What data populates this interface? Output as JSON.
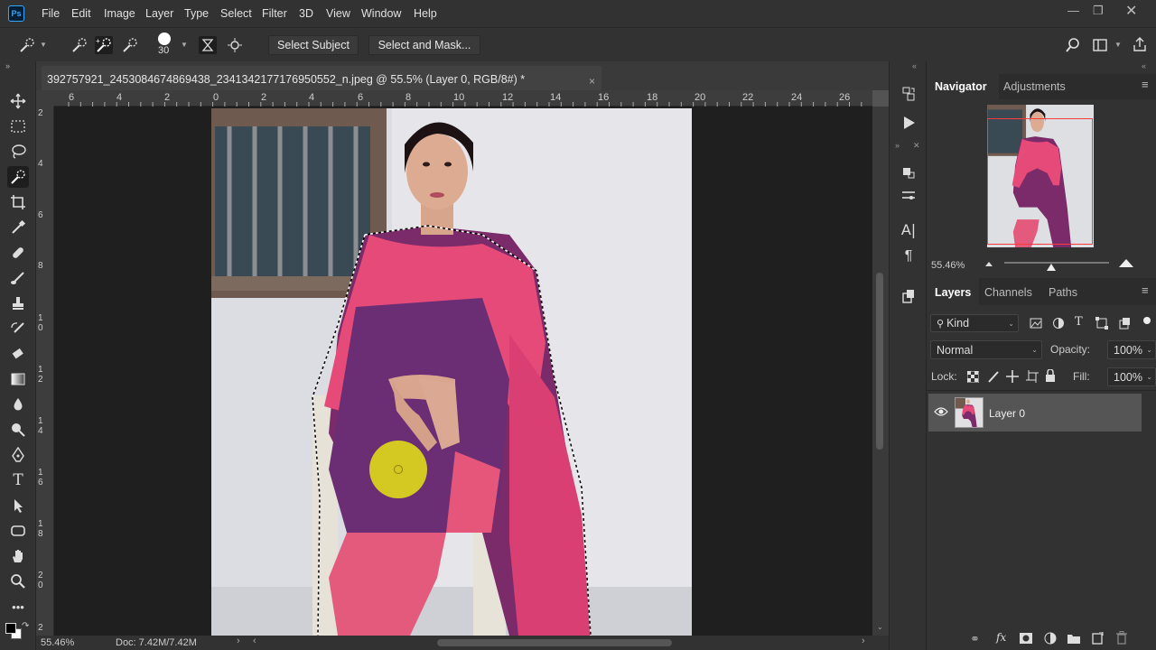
{
  "app": {
    "logo_text": "Ps"
  },
  "menu": [
    "File",
    "Edit",
    "Image",
    "Layer",
    "Type",
    "Select",
    "Filter",
    "3D",
    "View",
    "Window",
    "Help"
  ],
  "options": {
    "brush_size": "30",
    "select_subject_label": "Select Subject",
    "select_and_mask_label": "Select and Mask..."
  },
  "document": {
    "tab_title": "392757921_2453084674869438_2341342177176950552_n.jpeg @ 55.5% (Layer 0, RGB/8#) *",
    "close_glyph": "×"
  },
  "ruler": {
    "top_labels": [
      "6",
      "4",
      "2",
      "0",
      "2",
      "4",
      "6",
      "8",
      "10",
      "12",
      "14",
      "16",
      "18",
      "20",
      "22",
      "24",
      "26"
    ],
    "left_labels": [
      "2",
      "4",
      "6",
      "8",
      "1 0",
      "1 2",
      "1 4",
      "1 6",
      "1 8",
      "2 0",
      "2"
    ]
  },
  "status": {
    "zoom": "55.46%",
    "doc": "Doc: 7.42M/7.42M"
  },
  "navigator": {
    "tab_active": "Navigator",
    "tab_other": "Adjustments",
    "zoom": "55.46%"
  },
  "layers": {
    "tabs": [
      "Layers",
      "Channels",
      "Paths"
    ],
    "filter_kind": "Kind",
    "blend_mode": "Normal",
    "opacity_label": "Opacity:",
    "opacity_value": "100%",
    "lock_label": "Lock:",
    "fill_label": "Fill:",
    "fill_value": "100%",
    "items": [
      {
        "name": "Layer 0",
        "visible": true
      }
    ]
  },
  "colors": {
    "accent": "#31a8ff",
    "panel": "#323232",
    "canvas_bg": "#1f1f1f",
    "cursor": "#d9d21e"
  }
}
